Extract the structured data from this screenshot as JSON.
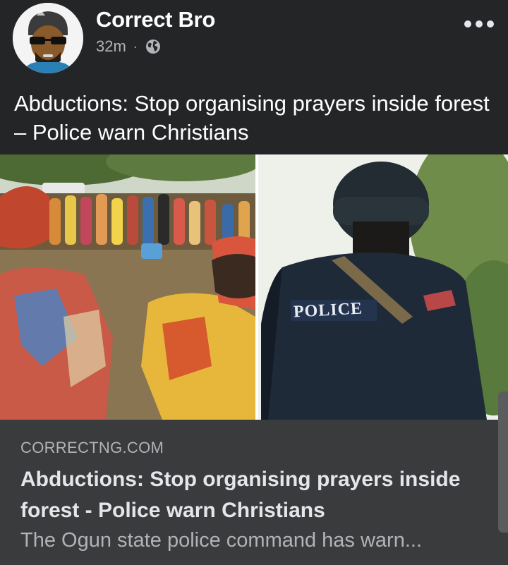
{
  "post": {
    "author": "Correct Bro",
    "time": "32m",
    "separator": "·",
    "privacy_icon": "globe-icon",
    "more_icon": "more-horizontal-icon",
    "text": "Abductions: Stop organising prayers inside forest – Police warn Christians"
  },
  "link_preview": {
    "domain": "CORRECTNG.COM",
    "title": "Abductions: Stop organising prayers inside forest - Police warn Christians",
    "description": "The Ogun state police command has warn...",
    "image_label": "POLICE"
  },
  "colors": {
    "background": "#242526",
    "link_footer": "#3a3b3c",
    "text_primary": "#e4e6eb",
    "text_secondary": "#b0b3b8"
  }
}
